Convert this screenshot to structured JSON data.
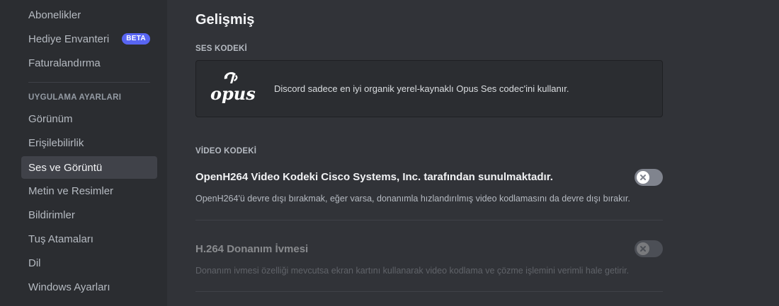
{
  "sidebar": {
    "items_top": [
      {
        "label": "Abonelikler"
      },
      {
        "label": "Hediye Envanteri",
        "badge": "BETA"
      },
      {
        "label": "Faturalandırma"
      }
    ],
    "section_header": "UYGULAMA AYARLARI",
    "items_app": [
      {
        "label": "Görünüm"
      },
      {
        "label": "Erişilebilirlik"
      },
      {
        "label": "Ses ve Görüntü",
        "selected": true
      },
      {
        "label": "Metin ve Resimler"
      },
      {
        "label": "Bildirimler"
      },
      {
        "label": "Tuş Atamaları"
      },
      {
        "label": "Dil"
      },
      {
        "label": "Windows Ayarları"
      }
    ]
  },
  "main": {
    "title": "Gelişmiş",
    "audio_codec": {
      "header": "SES KODEKİ",
      "logo_icon": "opus-logo-icon",
      "description": "Discord sadece en iyi organik yerel-kaynaklı Opus Ses codec'ini kullanır."
    },
    "video_codec": {
      "header": "VİDEO KODEKİ",
      "rows": [
        {
          "title": "OpenH264 Video Kodeki Cisco Systems, Inc. tarafından sunulmaktadır.",
          "description": "OpenH264'ü devre dışı bırakmak, eğer varsa, donanımla hızlandırılmış video kodlamasını da devre dışı bırakır.",
          "toggle_on": false,
          "disabled": false
        },
        {
          "title": "H.264 Donanım İvmesi",
          "description": "Donanım ivmesi özelliği mevcutsa ekran kartını kullanarak video kodlama ve çözme işlemini verimli hale getirir.",
          "toggle_on": false,
          "disabled": true
        }
      ]
    }
  },
  "colors": {
    "background": "#313338",
    "sidebar": "#2b2d31",
    "selected": "#404249",
    "accent": "#5865f2",
    "toggle_off": "#80848e"
  }
}
